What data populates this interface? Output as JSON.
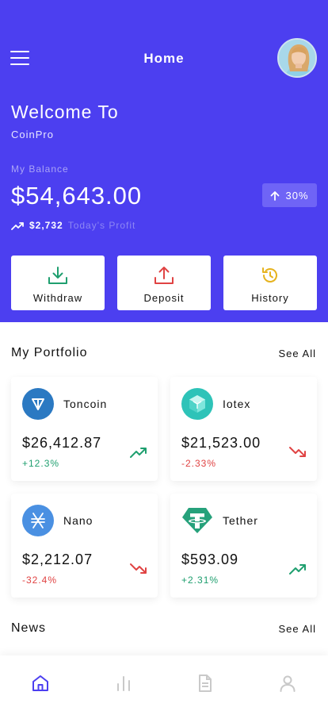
{
  "header": {
    "title": "Home",
    "welcome": "Welcome To",
    "app_name": "CoinPro",
    "balance_label": "My Balance",
    "balance": "$54,643.00",
    "percent_badge": "30%",
    "profit_amount": "$2,732",
    "profit_label": "Today's Profit"
  },
  "actions": [
    {
      "label": "Withdraw",
      "icon": "download-icon"
    },
    {
      "label": "Deposit",
      "icon": "upload-icon"
    },
    {
      "label": "History",
      "icon": "history-icon"
    }
  ],
  "portfolio": {
    "title": "My Portfolio",
    "see_all": "See All",
    "coins": [
      {
        "name": "Toncoin",
        "price": "$26,412.87",
        "change": "+12.3%",
        "trend": "up"
      },
      {
        "name": "Iotex",
        "price": "$21,523.00",
        "change": "-2.33%",
        "trend": "down"
      },
      {
        "name": "Nano",
        "price": "$2,212.07",
        "change": "-32.4%",
        "trend": "down"
      },
      {
        "name": "Tether",
        "price": "$593.09",
        "change": "+2.31%",
        "trend": "up"
      }
    ]
  },
  "news": {
    "title": "News",
    "see_all": "See All"
  },
  "bottom_nav": [
    {
      "icon": "home-icon",
      "active": true
    },
    {
      "icon": "chart-icon",
      "active": false
    },
    {
      "icon": "document-icon",
      "active": false
    },
    {
      "icon": "profile-icon",
      "active": false
    }
  ],
  "colors": {
    "primary": "#4c3ff0",
    "up": "#1f9f6f",
    "down": "#e04343",
    "history_accent": "#e6b31e"
  }
}
